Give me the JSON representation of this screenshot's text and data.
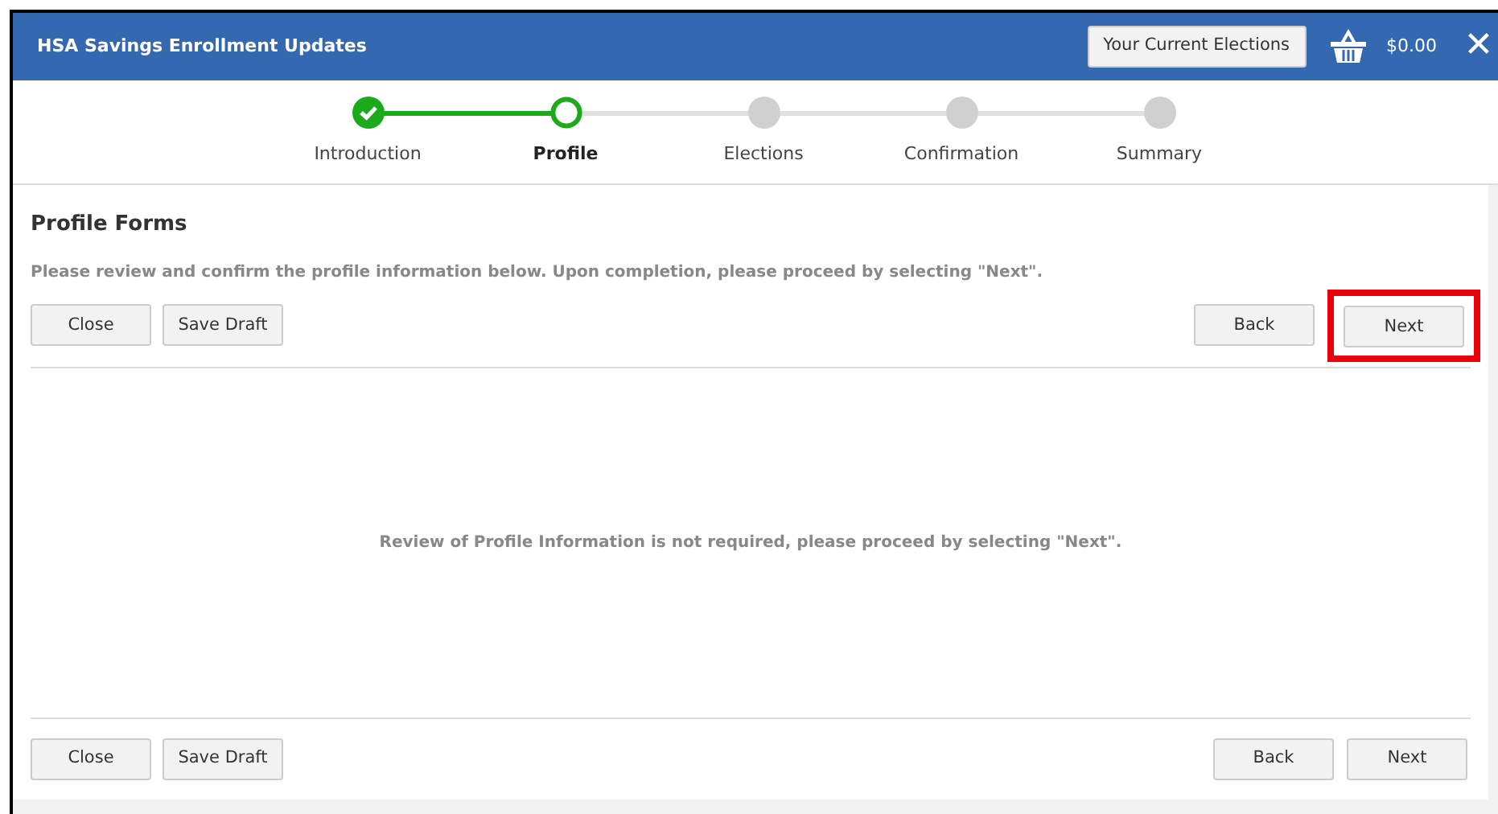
{
  "header": {
    "title": "HSA Savings Enrollment Updates",
    "elections_button": "Your Current Elections",
    "cart_total": "$0.00",
    "close": "✕"
  },
  "steps": [
    {
      "label": "Introduction",
      "completed": true,
      "selected": false
    },
    {
      "label": "Profile",
      "completed": false,
      "selected": true
    },
    {
      "label": "Elections",
      "completed": false,
      "selected": false
    },
    {
      "label": "Confirmation",
      "completed": false,
      "selected": false
    },
    {
      "label": "Summary",
      "completed": false,
      "selected": false
    }
  ],
  "section": {
    "title": "Profile Forms",
    "instructions": "Please review and confirm the profile information below. Upon completion, please proceed by selecting \"Next\"."
  },
  "top_actions": {
    "left": [
      {
        "label": "Close",
        "highlighted": false
      },
      {
        "label": "Save Draft",
        "highlighted": false
      }
    ],
    "right": [
      {
        "label": "Back",
        "highlighted": false
      },
      {
        "label": "Next",
        "highlighted": true
      }
    ]
  },
  "message": "Review of Profile Information is not required, please proceed by selecting \"Next\".",
  "bottom_actions": {
    "left": [
      {
        "label": "Close",
        "highlighted": false
      },
      {
        "label": "Save Draft",
        "highlighted": false
      }
    ],
    "right": [
      {
        "label": "Back",
        "highlighted": false
      },
      {
        "label": "Next",
        "highlighted": false
      }
    ]
  }
}
